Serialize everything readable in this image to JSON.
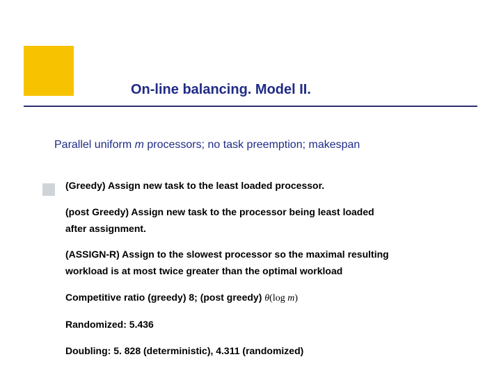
{
  "title": "On-line balancing. Model II.",
  "subtitle": {
    "prefix": "Parallel uniform ",
    "m": "m",
    "suffix": " processors; no task preemption; makespan"
  },
  "body": {
    "greedy": "(Greedy) Assign new task to the least loaded processor.",
    "post_greedy_line1": "(post Greedy) Assign new task to the processor being least loaded",
    "post_greedy_line2": "after assignment.",
    "assign_r_line1": "(ASSIGN-R) Assign to the slowest processor so the maximal resulting",
    "assign_r_line2": "workload is at most twice greater than the optimal workload",
    "competitive_prefix": "Competitive ratio (greedy) 8; (post greedy) ",
    "competitive_formula_theta": "θ",
    "competitive_formula_open": "(",
    "competitive_formula_log": "log ",
    "competitive_formula_m": "m",
    "competitive_formula_close": ")",
    "randomized": "Randomized: 5.436",
    "doubling": "Doubling: 5. 828 (deterministic), 4.311 (randomized)"
  }
}
